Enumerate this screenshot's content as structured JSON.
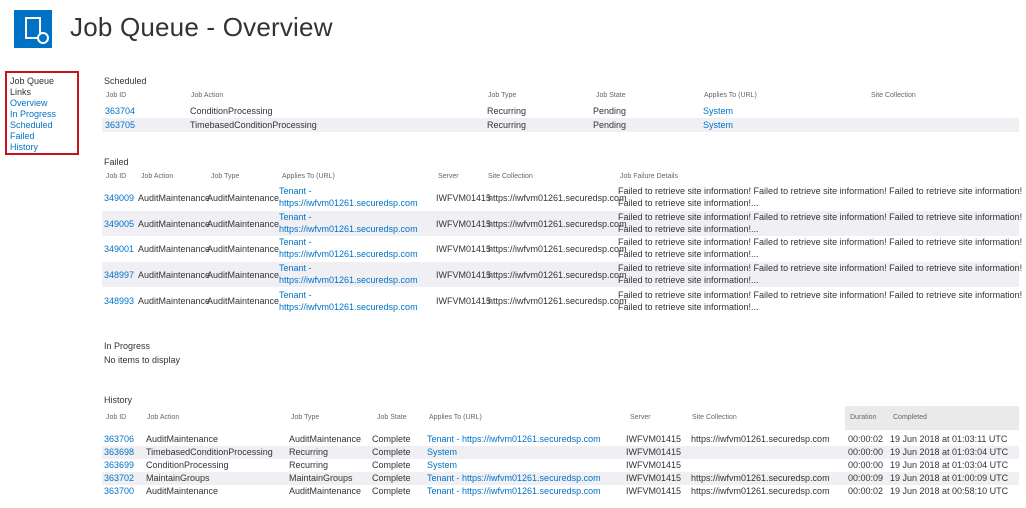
{
  "page": {
    "title": "Job Queue - Overview"
  },
  "nav": {
    "heading": "Job Queue Links",
    "items": [
      "Overview",
      "In Progress",
      "Scheduled",
      "Failed",
      "History"
    ]
  },
  "scheduled": {
    "title": "Scheduled",
    "headers": [
      "Job ID",
      "Job Action",
      "Job Type",
      "Job State",
      "Applies To (URL)",
      "Site Collection"
    ],
    "rows": [
      {
        "id": "363704",
        "action": "ConditionProcessing",
        "type": "Recurring",
        "state": "Pending",
        "applies": "System",
        "site": ""
      },
      {
        "id": "363705",
        "action": "TimebasedConditionProcessing",
        "type": "Recurring",
        "state": "Pending",
        "applies": "System",
        "site": ""
      }
    ]
  },
  "failed": {
    "title": "Failed",
    "headers": [
      "Job ID",
      "Job Action",
      "Job Type",
      "Applies To (URL)",
      "Server",
      "Site Collection",
      "Job Failure Details"
    ],
    "rows": [
      {
        "id": "349009",
        "action": "AuditMaintenance",
        "type": "AuditMaintenance",
        "applies1": "Tenant -",
        "applies2": "https://iwfvm01261.securedsp.com",
        "server": "IWFVM01415",
        "site": "https://iwfvm01261.securedsp.com",
        "detail1": "Failed to retrieve site information! Failed to retrieve site information! Failed to retrieve site information!",
        "detail2": "Failed to retrieve site information!..."
      },
      {
        "id": "349005",
        "action": "AuditMaintenance",
        "type": "AuditMaintenance",
        "applies1": "Tenant -",
        "applies2": "https://iwfvm01261.securedsp.com",
        "server": "IWFVM01415",
        "site": "https://iwfvm01261.securedsp.com",
        "detail1": "Failed to retrieve site information! Failed to retrieve site information! Failed to retrieve site information!",
        "detail2": "Failed to retrieve site information!..."
      },
      {
        "id": "349001",
        "action": "AuditMaintenance",
        "type": "AuditMaintenance",
        "applies1": "Tenant -",
        "applies2": "https://iwfvm01261.securedsp.com",
        "server": "IWFVM01415",
        "site": "https://iwfvm01261.securedsp.com",
        "detail1": "Failed to retrieve site information! Failed to retrieve site information! Failed to retrieve site information!",
        "detail2": "Failed to retrieve site information!..."
      },
      {
        "id": "348997",
        "action": "AuditMaintenance",
        "type": "AuditMaintenance",
        "applies1": "Tenant -",
        "applies2": "https://iwfvm01261.securedsp.com",
        "server": "IWFVM01415",
        "site": "https://iwfvm01261.securedsp.com",
        "detail1": "Failed to retrieve site information! Failed to retrieve site information! Failed to retrieve site information!",
        "detail2": "Failed to retrieve site information!..."
      },
      {
        "id": "348993",
        "action": "AuditMaintenance",
        "type": "AuditMaintenance",
        "applies1": "Tenant -",
        "applies2": "https://iwfvm01261.securedsp.com",
        "server": "IWFVM01415",
        "site": "https://iwfvm01261.securedsp.com",
        "detail1": "Failed to retrieve site information! Failed to retrieve site information! Failed to retrieve site information!",
        "detail2": "Failed to retrieve site information!..."
      }
    ]
  },
  "inprogress": {
    "title": "In Progress",
    "empty": "No items to display"
  },
  "history": {
    "title": "History",
    "headers": [
      "Job ID",
      "Job Action",
      "Job Type",
      "Job State",
      "Applies To (URL)",
      "Server",
      "Site Collection",
      "Duration",
      "Completed"
    ],
    "rows": [
      {
        "id": "363706",
        "action": "AuditMaintenance",
        "type": "AuditMaintenance",
        "state": "Complete",
        "applies": "Tenant - https://iwfvm01261.securedsp.com",
        "server": "IWFVM01415",
        "site": "https://iwfvm01261.securedsp.com",
        "duration": "00:00:02",
        "completed": "19 Jun 2018 at 01:03:11 UTC"
      },
      {
        "id": "363698",
        "action": "TimebasedConditionProcessing",
        "type": "Recurring",
        "state": "Complete",
        "applies": "System",
        "server": "IWFVM01415",
        "site": "",
        "duration": "00:00:00",
        "completed": "19 Jun 2018 at 01:03:04 UTC"
      },
      {
        "id": "363699",
        "action": "ConditionProcessing",
        "type": "Recurring",
        "state": "Complete",
        "applies": "System",
        "server": "IWFVM01415",
        "site": "",
        "duration": "00:00:00",
        "completed": "19 Jun 2018 at 01:03:04 UTC"
      },
      {
        "id": "363702",
        "action": "MaintainGroups",
        "type": "MaintainGroups",
        "state": "Complete",
        "applies": "Tenant - https://iwfvm01261.securedsp.com",
        "server": "IWFVM01415",
        "site": "https://iwfvm01261.securedsp.com",
        "duration": "00:00:09",
        "completed": "19 Jun 2018 at 01:00:09 UTC"
      },
      {
        "id": "363700",
        "action": "AuditMaintenance",
        "type": "AuditMaintenance",
        "state": "Complete",
        "applies": "Tenant - https://iwfvm01261.securedsp.com",
        "server": "IWFVM01415",
        "site": "https://iwfvm01261.securedsp.com",
        "duration": "00:00:02",
        "completed": "19 Jun 2018 at 00:58:10 UTC"
      }
    ]
  }
}
